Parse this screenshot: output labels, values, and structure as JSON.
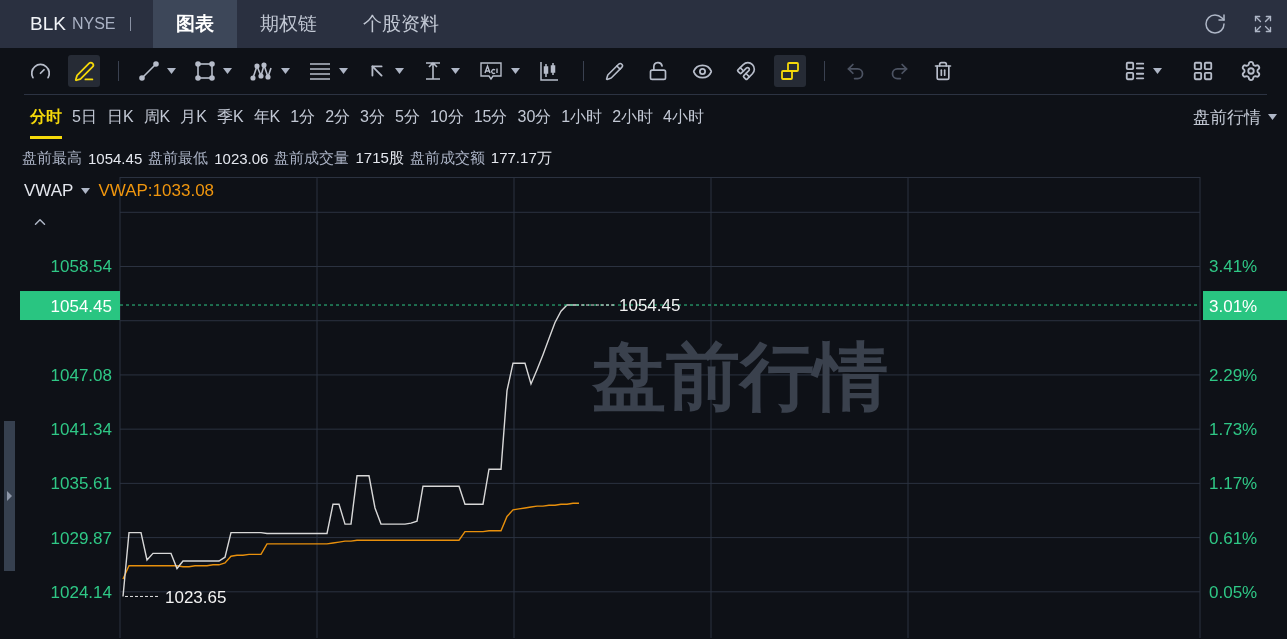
{
  "header": {
    "symbol": "BLK",
    "exchange": "NYSE",
    "tabs": [
      {
        "label": "图表",
        "selected": true
      },
      {
        "label": "期权链",
        "selected": false
      },
      {
        "label": "个股资料",
        "selected": false
      }
    ]
  },
  "toolbar": [
    {
      "kind": "tool",
      "active": false,
      "disabled": false
    },
    {
      "kind": "tool",
      "active": true,
      "disabled": false
    },
    {
      "kind": "divider"
    },
    {
      "kind": "menu",
      "active": false,
      "disabled": false
    },
    {
      "kind": "menu",
      "active": false,
      "disabled": false
    },
    {
      "kind": "menu",
      "active": false,
      "disabled": false
    },
    {
      "kind": "menu",
      "active": false,
      "disabled": false
    },
    {
      "kind": "menu",
      "active": false,
      "disabled": false
    },
    {
      "kind": "menu",
      "active": false,
      "disabled": false
    },
    {
      "kind": "menu",
      "active": false,
      "disabled": false
    },
    {
      "kind": "tool",
      "active": false,
      "disabled": false
    },
    {
      "kind": "divider"
    },
    {
      "kind": "tool",
      "active": false,
      "disabled": false
    },
    {
      "kind": "tool",
      "active": false,
      "disabled": false
    },
    {
      "kind": "tool",
      "active": false,
      "disabled": false
    },
    {
      "kind": "tool",
      "active": false,
      "disabled": false
    },
    {
      "kind": "tool",
      "active": true,
      "disabled": false
    },
    {
      "kind": "divider"
    },
    {
      "kind": "tool",
      "active": false,
      "disabled": true
    },
    {
      "kind": "tool",
      "active": false,
      "disabled": true
    },
    {
      "kind": "tool",
      "active": false,
      "disabled": false
    }
  ],
  "periods": [
    {
      "label": "分时",
      "selected": true
    },
    {
      "label": "5日",
      "selected": false
    },
    {
      "label": "日K",
      "selected": false
    },
    {
      "label": "周K",
      "selected": false
    },
    {
      "label": "月K",
      "selected": false
    },
    {
      "label": "季K",
      "selected": false
    },
    {
      "label": "年K",
      "selected": false
    },
    {
      "label": "1分",
      "selected": false
    },
    {
      "label": "2分",
      "selected": false
    },
    {
      "label": "3分",
      "selected": false
    },
    {
      "label": "5分",
      "selected": false
    },
    {
      "label": "10分",
      "selected": false
    },
    {
      "label": "15分",
      "selected": false
    },
    {
      "label": "30分",
      "selected": false
    },
    {
      "label": "1小时",
      "selected": false
    },
    {
      "label": "2小时",
      "selected": false
    },
    {
      "label": "4小时",
      "selected": false
    }
  ],
  "session_select": {
    "value": "盘前行情"
  },
  "stats": [
    {
      "label": "盘前最高",
      "value": "1054.45"
    },
    {
      "label": "盘前最低",
      "value": "1023.06"
    },
    {
      "label": "盘前成交量",
      "value": "1715股"
    },
    {
      "label": "盘前成交额",
      "value": "177.17万"
    }
  ],
  "indicator": {
    "reading": "VWAP:1033.08"
  },
  "chart": {
    "watermark": "盘前行情",
    "last_change_tag": "3.01%",
    "high_label": "1054.45",
    "low_label": "1023.65",
    "right_labels": [
      "3.41%",
      "2.29%",
      "1.73%",
      "1.17%",
      "0.61%",
      "0.05%"
    ],
    "chart_data": {
      "type": "line",
      "grid": true,
      "ylim": [
        1019.26,
        1067.98
      ],
      "yticks": [
        1058.54,
        1047.08,
        1041.34,
        1035.61,
        1029.87,
        1024.14
      ],
      "ref_lines": [
        {
          "axis": "y",
          "value": 1054.45,
          "label": "1054.45",
          "color": "#2fc886"
        }
      ],
      "categories": [
        null,
        null,
        null,
        null,
        null,
        null,
        null,
        null,
        null,
        null,
        null,
        null,
        null,
        null,
        null,
        null,
        null,
        null,
        null,
        null,
        null,
        null,
        null,
        null,
        null,
        null,
        null,
        null,
        null,
        null,
        null,
        null,
        null,
        null,
        null,
        null,
        null,
        null,
        null,
        null,
        null,
        null,
        null,
        null,
        null,
        null,
        null,
        null,
        null,
        null,
        null,
        null,
        null,
        null,
        null,
        null,
        null,
        null,
        null,
        null,
        null,
        null,
        null,
        null,
        null,
        null,
        null,
        null,
        null,
        null,
        null,
        null,
        null,
        null,
        null,
        null,
        null,
        null,
        null,
        null,
        null,
        null,
        null,
        null,
        null,
        null,
        null,
        null,
        null,
        null,
        null,
        null,
        null,
        null,
        null,
        null,
        null,
        null,
        null,
        null,
        null,
        null,
        null,
        null,
        null,
        null,
        null,
        null,
        null,
        null,
        null,
        null,
        null,
        null,
        null,
        null,
        null,
        null,
        null,
        null,
        null,
        null,
        null,
        null,
        null,
        null,
        null,
        null,
        null,
        null,
        null,
        null,
        null,
        null,
        null,
        null,
        null,
        null,
        null,
        null,
        null,
        null,
        null,
        null,
        null,
        null,
        null,
        null,
        null,
        null,
        null,
        null,
        null,
        null,
        null,
        null,
        null,
        null,
        null,
        null,
        null,
        null,
        null,
        null,
        null,
        null,
        null,
        null,
        null,
        null,
        null,
        null,
        null,
        null,
        null,
        null,
        null,
        null,
        null,
        null
      ],
      "series": [
        {
          "color": "#d8d8d8",
          "values": [
            1023.65,
            1030.4,
            1030.4,
            1030.4,
            1027.5,
            1028.2,
            1028.2,
            1028.2,
            1028.2,
            1026.6,
            1027.4,
            1027.4,
            1027.4,
            1027.4,
            1027.4,
            1027.4,
            1027.4,
            1027.8,
            1030.4,
            1030.4,
            1030.4,
            1030.4,
            1030.4,
            1030.4,
            1030.3,
            1030.3,
            1030.3,
            1030.3,
            1030.3,
            1030.3,
            1030.3,
            1030.3,
            1030.3,
            1030.3,
            1030.3,
            1033.4,
            1033.4,
            1031.3,
            1031.3,
            1036.4,
            1036.4,
            1036.4,
            1033.0,
            1031.3,
            1031.3,
            1031.3,
            1031.3,
            1031.3,
            1031.4,
            1031.6,
            1035.3,
            1035.3,
            1035.3,
            1035.3,
            1035.3,
            1035.3,
            1035.3,
            1033.4,
            1033.4,
            1033.4,
            1033.4,
            1037.1,
            1037.1,
            1037.1,
            1045.4,
            1048.3,
            1048.3,
            1048.3,
            1046.1,
            1047.6,
            1049.2,
            1050.9,
            1052.6,
            1053.8,
            1054.45,
            1054.45,
            1054.45,
            null,
            null,
            null,
            null,
            null,
            null,
            null,
            null,
            null,
            null,
            null,
            null,
            null,
            null,
            null,
            null,
            null,
            null,
            null,
            null,
            null,
            null,
            null,
            null,
            null,
            null,
            null,
            null,
            null,
            null,
            null,
            null,
            null,
            null,
            null,
            null,
            null,
            null,
            null,
            null,
            null,
            null,
            null,
            null,
            null,
            null,
            null,
            null,
            null,
            null,
            null,
            null,
            null,
            null,
            null,
            null,
            null,
            null,
            null,
            null,
            null,
            null,
            null,
            null,
            null,
            null,
            null,
            null,
            null,
            null,
            null,
            null,
            null,
            null,
            null,
            null,
            null,
            null,
            null,
            null,
            null,
            null,
            null,
            null,
            null,
            null,
            null,
            null,
            null,
            null,
            null,
            null,
            null,
            null,
            null,
            null,
            null,
            null,
            null,
            null,
            null,
            null,
            null
          ]
        },
        {
          "name": "VWAP",
          "color": "#e8900c",
          "values": [
            1025.5,
            1026.9,
            1026.9,
            1026.9,
            1026.9,
            1026.9,
            1026.9,
            1026.9,
            1026.9,
            1026.9,
            1026.8,
            1026.8,
            1026.9,
            1026.9,
            1026.9,
            1027.0,
            1027.0,
            1027.2,
            1027.9,
            1028.0,
            1028.0,
            1028.1,
            1028.1,
            1028.1,
            1029.2,
            1029.2,
            1029.2,
            1029.2,
            1029.2,
            1029.2,
            1029.2,
            1029.2,
            1029.2,
            1029.2,
            1029.2,
            1029.3,
            1029.4,
            1029.5,
            1029.5,
            1029.6,
            1029.6,
            1029.6,
            1029.6,
            1029.6,
            1029.6,
            1029.6,
            1029.6,
            1029.6,
            1029.6,
            1029.6,
            1029.6,
            1029.6,
            1029.6,
            1029.6,
            1029.6,
            1029.6,
            1029.6,
            1030.5,
            1030.5,
            1030.5,
            1030.5,
            1030.6,
            1030.6,
            1030.6,
            1032.1,
            1032.8,
            1032.9,
            1033.0,
            1033.1,
            1033.2,
            1033.2,
            1033.3,
            1033.3,
            1033.4,
            1033.4,
            1033.5,
            1033.5,
            null,
            null,
            null,
            null,
            null,
            null,
            null,
            null,
            null,
            null,
            null,
            null,
            null,
            null,
            null,
            null,
            null,
            null,
            null,
            null,
            null,
            null,
            null,
            null,
            null,
            null,
            null,
            null,
            null,
            null,
            null,
            null,
            null,
            null,
            null,
            null,
            null,
            null,
            null,
            null,
            null,
            null,
            null,
            null,
            null,
            null,
            null,
            null,
            null,
            null,
            null,
            null,
            null,
            null,
            null,
            null,
            null,
            null,
            null,
            null,
            null,
            null,
            null,
            null,
            null,
            null,
            null,
            null,
            null,
            null,
            null,
            null,
            null,
            null,
            null,
            null,
            null,
            null,
            null,
            null,
            null,
            null,
            null,
            null,
            null,
            null,
            null,
            null,
            null,
            null,
            null,
            null,
            null,
            null,
            null,
            null,
            null,
            null,
            null,
            null,
            null,
            null,
            null
          ]
        }
      ]
    }
  }
}
